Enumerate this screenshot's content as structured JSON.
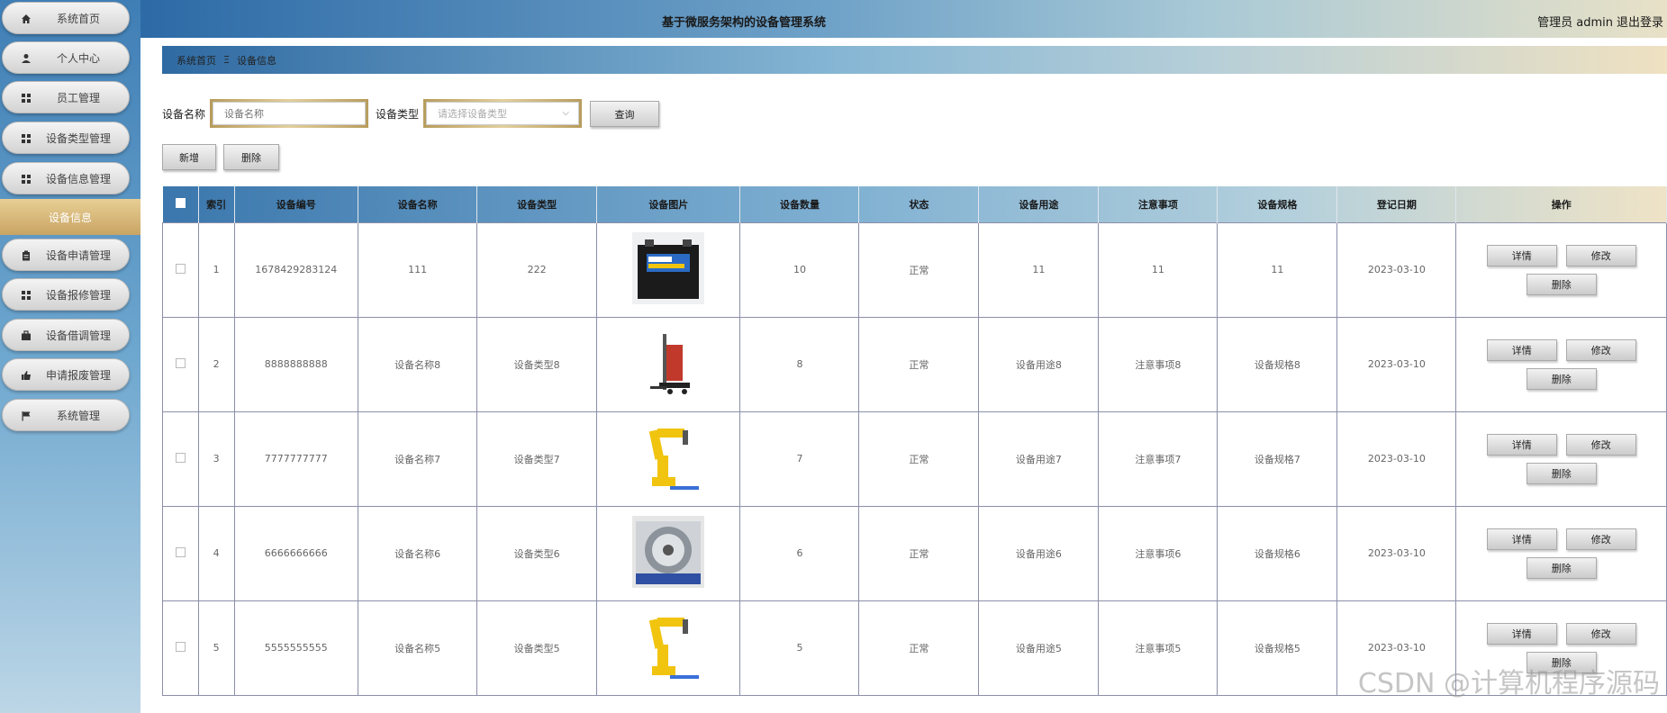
{
  "app": {
    "title": "基于微服务架构的设备管理系统",
    "user": "管理员 admin",
    "logout": "退出登录"
  },
  "sidebar": {
    "items": [
      {
        "label": "系统首页",
        "icon": "home-icon"
      },
      {
        "label": "个人中心",
        "icon": "user-icon"
      },
      {
        "label": "员工管理",
        "icon": "grid-icon"
      },
      {
        "label": "设备类型管理",
        "icon": "grid-icon"
      },
      {
        "label": "设备信息管理",
        "icon": "grid-icon"
      },
      {
        "label": "设备申请管理",
        "icon": "clipboard-icon"
      },
      {
        "label": "设备报修管理",
        "icon": "grid-icon"
      },
      {
        "label": "设备借调管理",
        "icon": "briefcase-icon"
      },
      {
        "label": "申请报废管理",
        "icon": "thumbs-up-icon"
      },
      {
        "label": "系统管理",
        "icon": "flag-icon"
      }
    ],
    "active_sub": "设备信息"
  },
  "breadcrumb": {
    "home": "系统首页",
    "separator": "Ξ",
    "current": "设备信息"
  },
  "search": {
    "name_label": "设备名称",
    "name_placeholder": "设备名称",
    "type_label": "设备类型",
    "type_placeholder": "请选择设备类型",
    "query_button": "查询"
  },
  "toolbar": {
    "add_button": "新增",
    "delete_button": "删除"
  },
  "table": {
    "columns": [
      "索引",
      "设备编号",
      "设备名称",
      "设备类型",
      "设备图片",
      "设备数量",
      "状态",
      "设备用途",
      "注意事项",
      "设备规格",
      "登记日期",
      "操作"
    ],
    "actions": {
      "detail": "详情",
      "edit": "修改",
      "delete": "删除"
    },
    "rows": [
      {
        "index": "1",
        "code": "1678429283124",
        "name": "111",
        "type": "222",
        "image": "battery-image",
        "count": "10",
        "status": "正常",
        "usage": "11",
        "notes": "11",
        "spec": "11",
        "date": "2023-03-10"
      },
      {
        "index": "2",
        "code": "8888888888",
        "name": "设备名称8",
        "type": "设备类型8",
        "image": "forklift-image",
        "count": "8",
        "status": "正常",
        "usage": "设备用途8",
        "notes": "注意事项8",
        "spec": "设备规格8",
        "date": "2023-03-10"
      },
      {
        "index": "3",
        "code": "7777777777",
        "name": "设备名称7",
        "type": "设备类型7",
        "image": "robot-arm-image",
        "count": "7",
        "status": "正常",
        "usage": "设备用途7",
        "notes": "注意事项7",
        "spec": "设备规格7",
        "date": "2023-03-10"
      },
      {
        "index": "4",
        "code": "6666666666",
        "name": "设备名称6",
        "type": "设备类型6",
        "image": "machine-image",
        "count": "6",
        "status": "正常",
        "usage": "设备用途6",
        "notes": "注意事项6",
        "spec": "设备规格6",
        "date": "2023-03-10"
      },
      {
        "index": "5",
        "code": "5555555555",
        "name": "设备名称5",
        "type": "设备类型5",
        "image": "robot-arm-image",
        "count": "5",
        "status": "正常",
        "usage": "设备用途5",
        "notes": "注意事项5",
        "spec": "设备规格5",
        "date": "2023-03-10"
      }
    ]
  },
  "watermark": "CSDN @计算机程序源码"
}
